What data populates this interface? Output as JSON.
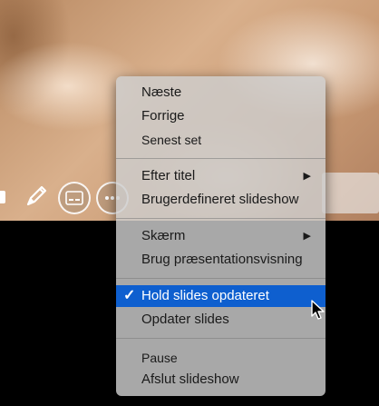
{
  "toolbar": {
    "icons": [
      "pen-tool-icon",
      "pencil-icon",
      "subtitles-icon",
      "more-icon"
    ]
  },
  "menu": {
    "group1": {
      "next": "Næste",
      "previous": "Forrige",
      "last_viewed": "Senest set"
    },
    "group2": {
      "by_title": "Efter titel",
      "custom_slideshow": "Brugerdefineret slideshow"
    },
    "group3": {
      "screen": "Skærm",
      "presenter_view": "Brug præsentationsvisning"
    },
    "group4": {
      "keep_updated": "Hold slides opdateret",
      "keep_updated_checked": true,
      "update_slides": "Opdater slides"
    },
    "group5": {
      "pause": "Pause",
      "end_show": "Afslut slideshow"
    },
    "submenu_arrow": "▶",
    "checkmark": "✓"
  },
  "colors": {
    "highlight": "#0e5fcf",
    "menu_bg": "#cdcdcd"
  }
}
